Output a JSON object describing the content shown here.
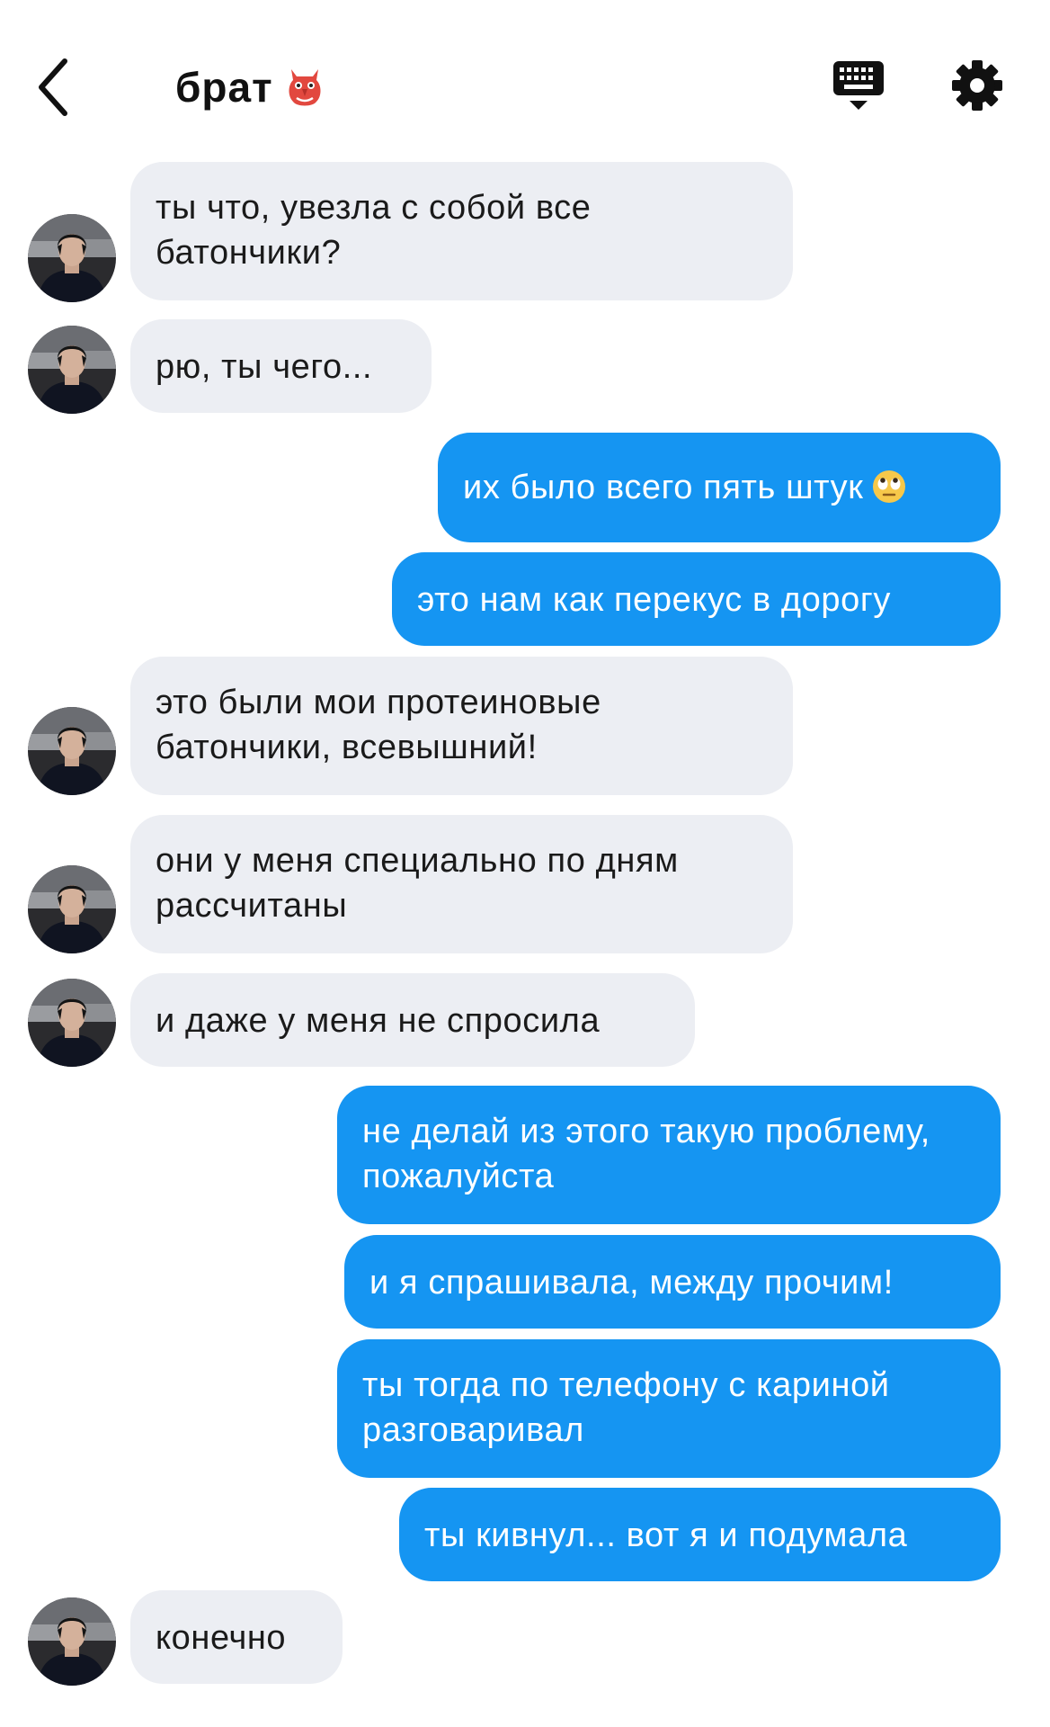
{
  "header": {
    "title": "брат",
    "title_emoji": "goblin-mask-emoji",
    "icons": [
      "back-chevron-icon",
      "keyboard-icon",
      "gear-icon"
    ]
  },
  "messages": [
    {
      "side": "in",
      "text": "ты что, увезла с собой все батончики?"
    },
    {
      "side": "in",
      "text": "рю, ты чего..."
    },
    {
      "side": "out",
      "text": "их было всего пять штук",
      "emoji": "eye-roll-emoji"
    },
    {
      "side": "out",
      "text": "это нам как перекус в дорогу"
    },
    {
      "side": "in",
      "text": "это были мои протеиновые батончики, всевышний!"
    },
    {
      "side": "in",
      "text": "они у меня специально по дням рассчитаны"
    },
    {
      "side": "in",
      "text": "и даже у меня не спросила"
    },
    {
      "side": "out",
      "text": "не делай из этого такую проблему, пожалуйста"
    },
    {
      "side": "out",
      "text": "и я спрашивала, между прочим!"
    },
    {
      "side": "out",
      "text": "ты тогда по телефону с кариной разговаривал"
    },
    {
      "side": "out",
      "text": "ты кивнул... вот я и подумала"
    },
    {
      "side": "in",
      "text": "конечно"
    }
  ],
  "colors": {
    "incoming_bubble": "#eceef3",
    "outgoing_bubble": "#1595f2",
    "outgoing_text": "#ffffff"
  }
}
